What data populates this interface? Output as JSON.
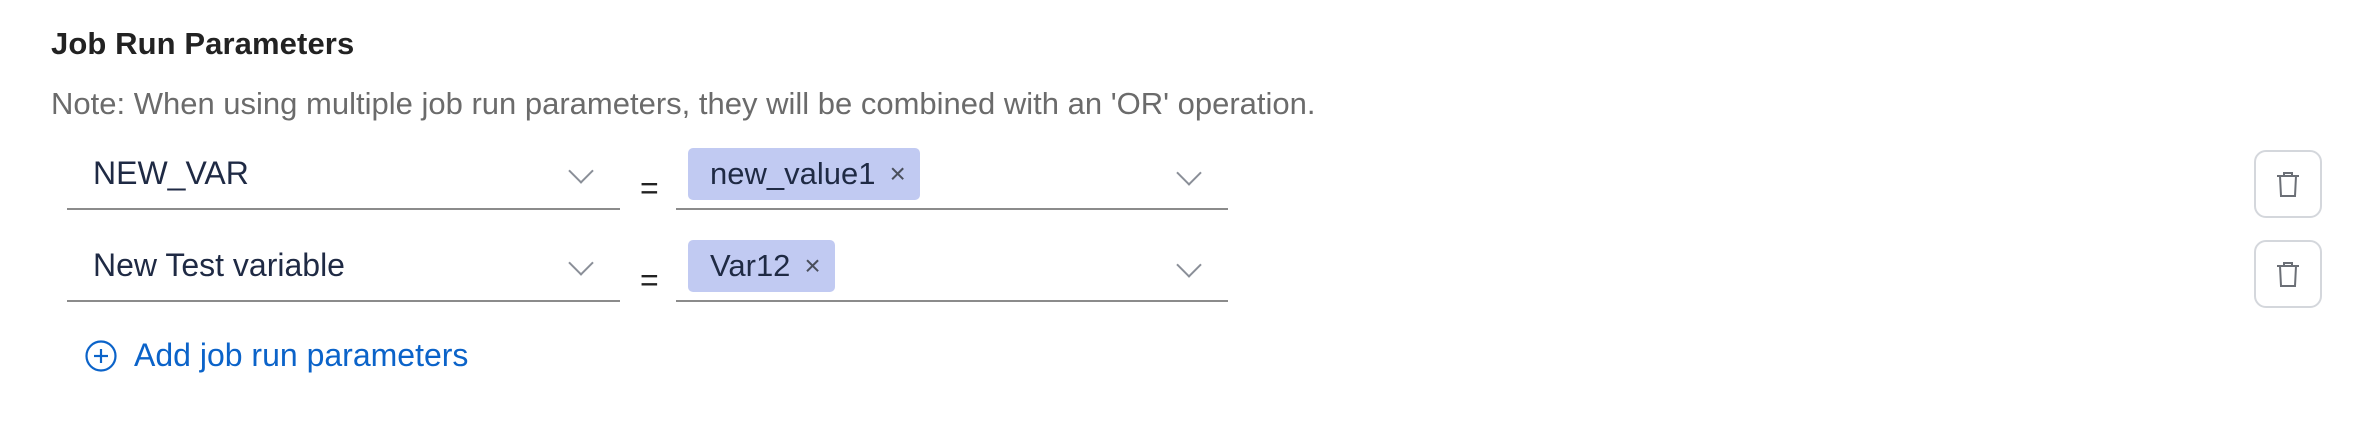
{
  "section": {
    "title": "Job Run Parameters",
    "note": "Note: When using multiple job run parameters, they will be combined with an 'OR' operation."
  },
  "operator": "=",
  "parameters": [
    {
      "variable": "NEW_VAR",
      "values": [
        "new_value1"
      ]
    },
    {
      "variable": "New Test variable",
      "values": [
        "Var12"
      ]
    }
  ],
  "add_button": {
    "label": "Add job run parameters"
  },
  "icons": {
    "dropdown": "chevron-down-icon",
    "remove_tag": "close-icon",
    "delete": "trash-icon",
    "add": "plus-circle-icon"
  },
  "colors": {
    "tag_background": "#c1caf2",
    "link": "#0b63c9"
  }
}
